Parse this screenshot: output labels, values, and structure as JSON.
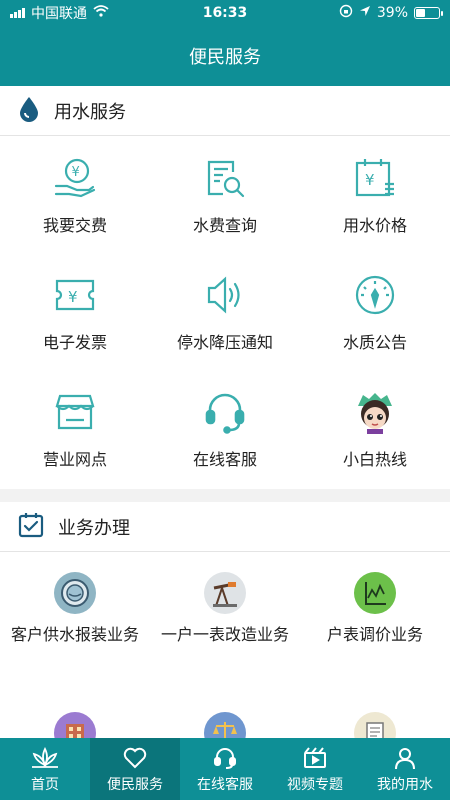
{
  "status_bar": {
    "carrier": "中国联通",
    "time": "16:33",
    "battery": "39%",
    "battery_level": 0.39
  },
  "nav": {
    "title": "便民服务"
  },
  "water_service": {
    "title": "用水服务",
    "items": [
      {
        "label": "我要交费",
        "icon": "payment-hand-icon"
      },
      {
        "label": "水费查询",
        "icon": "bill-search-icon"
      },
      {
        "label": "用水价格",
        "icon": "price-calendar-icon"
      },
      {
        "label": "电子发票",
        "icon": "invoice-ticket-icon"
      },
      {
        "label": "停水降压通知",
        "icon": "speaker-icon"
      },
      {
        "label": "水质公告",
        "icon": "gauge-icon"
      },
      {
        "label": "营业网点",
        "icon": "store-icon"
      },
      {
        "label": "在线客服",
        "icon": "headset-icon"
      },
      {
        "label": "小白热线",
        "icon": "mascot-icon"
      }
    ]
  },
  "business": {
    "title": "业务办理",
    "items": [
      {
        "label": "客户供水报装业务",
        "icon": "water-meter-icon"
      },
      {
        "label": "一户一表改造业务",
        "icon": "pump-icon"
      },
      {
        "label": "户表调价业务",
        "icon": "chart-icon"
      },
      {
        "label": "",
        "icon": "building-icon"
      },
      {
        "label": "",
        "icon": "scale-icon"
      },
      {
        "label": "",
        "icon": "document-icon"
      }
    ]
  },
  "tabs": [
    {
      "label": "首页",
      "icon": "lotus-icon"
    },
    {
      "label": "便民服务",
      "icon": "heart-icon",
      "active": true
    },
    {
      "label": "在线客服",
      "icon": "headset-icon"
    },
    {
      "label": "视频专题",
      "icon": "video-icon"
    },
    {
      "label": "我的用水",
      "icon": "person-icon"
    }
  ],
  "colors": {
    "primary": "#0e8f96",
    "icon_teal": "#3aaeae"
  }
}
